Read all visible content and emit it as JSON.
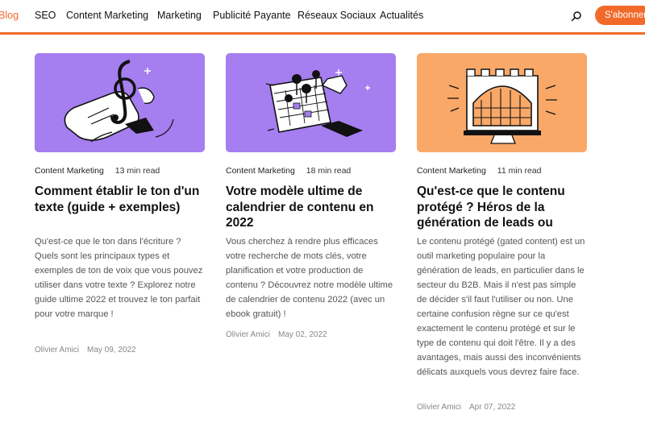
{
  "nav": {
    "items": [
      "Blog",
      "SEO",
      "Content Marketing",
      "Marketing",
      "Publicité Payante",
      "Réseaux Sociaux",
      "Actualités"
    ],
    "search_icon": "search-icon",
    "subscribe_label": "S'abonner",
    "accent_color": "#f26a2b"
  },
  "cards": [
    {
      "thumb_color": "#a57ef0",
      "image_icon": "treble-clef-hand-illustration",
      "category": "Content Marketing",
      "read_time": "13 min read",
      "title": "Comment établir le ton d'un texte (guide + exemples)",
      "excerpt": "Qu'est-ce que le ton dans l'écriture ? Quels sont les principaux types et exemples de ton de voix que vous pouvez utiliser dans votre texte ? Explorez notre guide ultime 2022 et trouvez le ton parfait pour votre marque !",
      "author": "Olivier Amici",
      "date": "May 09, 2022"
    },
    {
      "thumb_color": "#a57ef0",
      "image_icon": "calendar-pins-illustration",
      "category": "Content Marketing",
      "read_time": "18 min read",
      "title": "Votre modèle ultime de calendrier de contenu en 2022",
      "excerpt": "Vous cherchez à rendre plus efficaces votre recherche de mots clés, votre planification et votre production de contenu ? Découvrez notre modèle ultime de calendrier de contenu 2022 (avec un ebook gratuit) !",
      "author": "Olivier Amici",
      "date": "May 02, 2022"
    },
    {
      "thumb_color": "#f9a868",
      "image_icon": "castle-gate-screen-illustration",
      "category": "Content Marketing",
      "read_time": "11 min read",
      "title": "Qu'est-ce que le contenu protégé ? Héros de la génération de leads ou",
      "excerpt": "Le contenu protégé (gated content) est un outil marketing populaire pour la génération de leads, en particulier dans le secteur du B2B. Mais il n'est pas simple de décider s'il faut l'utiliser ou non. Une certaine confusion règne sur ce qu'est exactement le contenu protégé et sur le type de contenu qui doit l'être. Il y a des avantages, mais aussi des inconvénients délicats auxquels vous devrez faire face.",
      "author": "Olivier Amici",
      "date": "Apr 07, 2022"
    }
  ]
}
